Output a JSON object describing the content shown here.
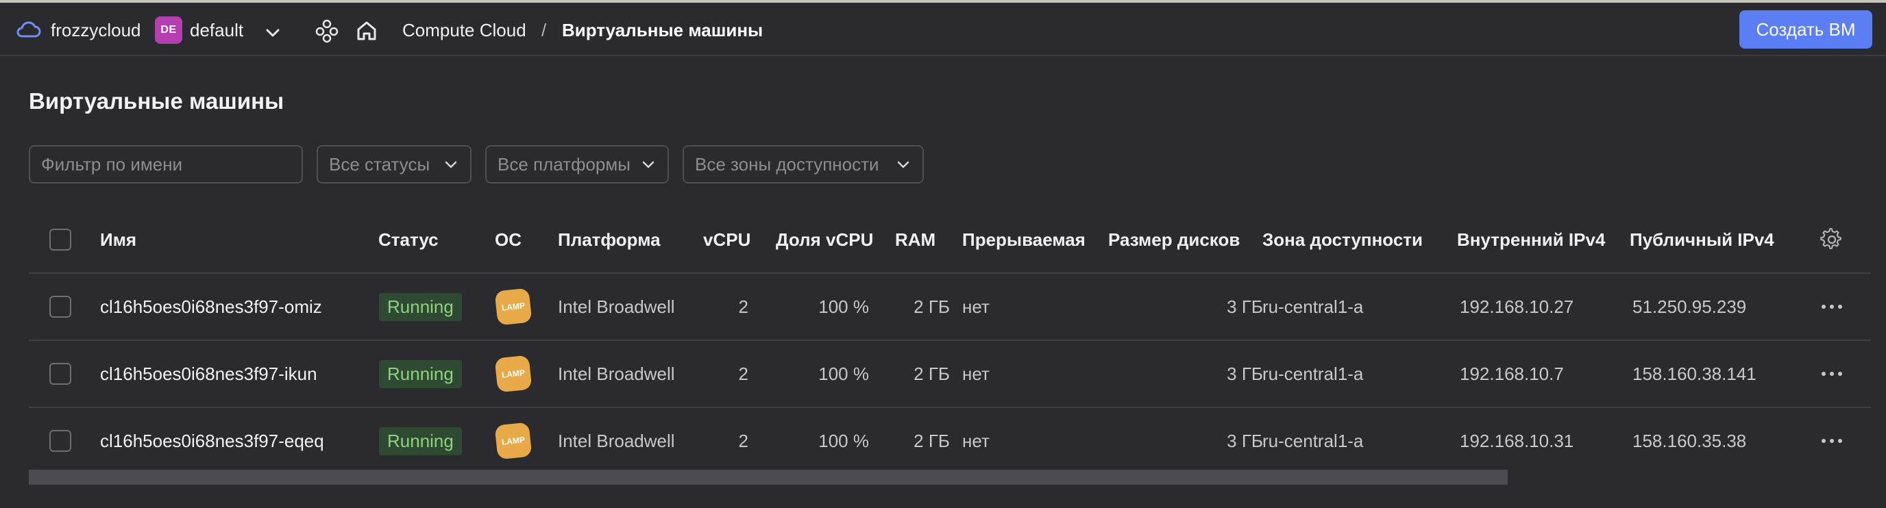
{
  "header": {
    "org_name": "frozzycloud",
    "folder_badge": "DE",
    "folder_name": "default",
    "breadcrumb_service": "Compute Cloud",
    "breadcrumb_separator": "/",
    "breadcrumb_current": "Виртуальные машины",
    "create_button": "Создать ВМ",
    "colors": {
      "accent": "#5b7ef5",
      "badge": "#b53fb0"
    }
  },
  "page": {
    "title": "Виртуальные машины"
  },
  "filters": {
    "name_placeholder": "Фильтр по имени",
    "status": "Все статусы",
    "platform": "Все платформы",
    "zone": "Все зоны доступности"
  },
  "table": {
    "columns": {
      "name": "Имя",
      "status": "Статус",
      "os": "ОС",
      "platform": "Платформа",
      "vcpu": "vCPU",
      "vcpu_share": "Доля vCPU",
      "ram": "RAM",
      "preemptible": "Прерываемая",
      "disk_size": "Размер дисков",
      "zone": "Зона доступности",
      "internal_ip": "Внутренний IPv4",
      "public_ip": "Публичный IPv4"
    },
    "rows": [
      {
        "name": "cl16h5oes0i68nes3f97-omiz",
        "status": "Running",
        "os": "LAMP",
        "platform": "Intel Broadwell",
        "vcpu": "2",
        "vcpu_share": "100 %",
        "ram": "2 ГБ",
        "preemptible": "нет",
        "disk_size": "3 ГБ",
        "zone": "ru-central1-a",
        "internal_ip": "192.168.10.27",
        "public_ip": "51.250.95.239"
      },
      {
        "name": "cl16h5oes0i68nes3f97-ikun",
        "status": "Running",
        "os": "LAMP",
        "platform": "Intel Broadwell",
        "vcpu": "2",
        "vcpu_share": "100 %",
        "ram": "2 ГБ",
        "preemptible": "нет",
        "disk_size": "3 ГБ",
        "zone": "ru-central1-a",
        "internal_ip": "192.168.10.7",
        "public_ip": "158.160.38.141"
      },
      {
        "name": "cl16h5oes0i68nes3f97-eqeq",
        "status": "Running",
        "os": "LAMP",
        "platform": "Intel Broadwell",
        "vcpu": "2",
        "vcpu_share": "100 %",
        "ram": "2 ГБ",
        "preemptible": "нет",
        "disk_size": "3 ГБ",
        "zone": "ru-central1-a",
        "internal_ip": "192.168.10.31",
        "public_ip": "158.160.35.38"
      }
    ]
  }
}
